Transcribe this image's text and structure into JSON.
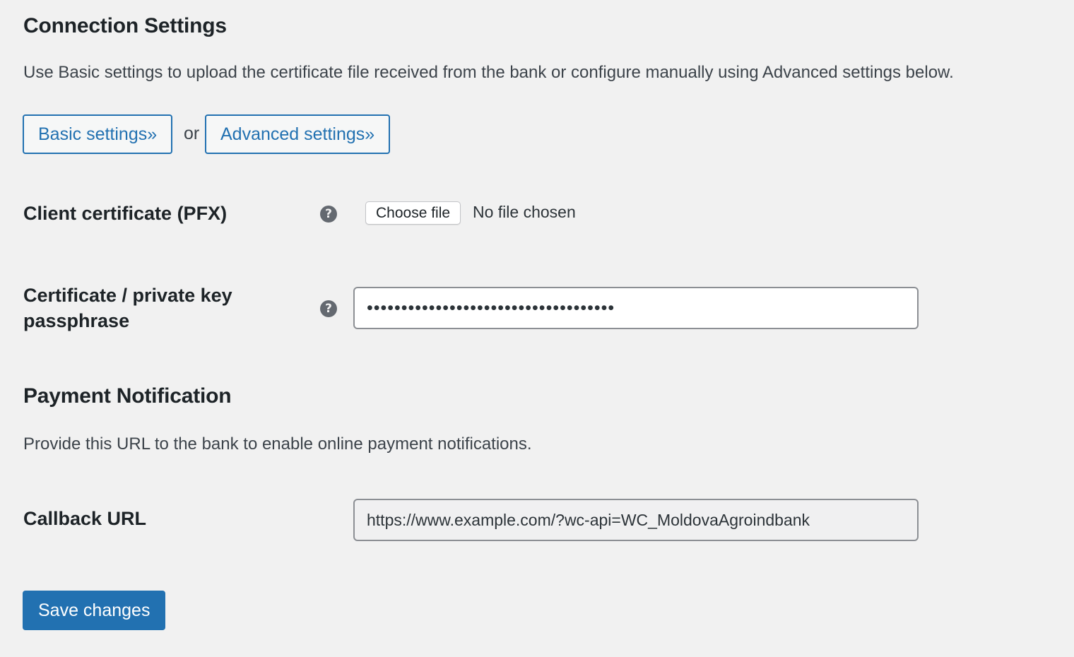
{
  "connection": {
    "title": "Connection Settings",
    "description": "Use Basic settings to upload the certificate file received from the bank or configure manually using Advanced settings below.",
    "basic_button": "Basic settings»",
    "or_text": "or",
    "advanced_button": "Advanced settings»"
  },
  "fields": {
    "certificate": {
      "label": "Client certificate (PFX)",
      "help_icon": "question-circle-icon",
      "choose_button": "Choose file",
      "status": "No file chosen"
    },
    "passphrase": {
      "label_line1": "Certificate / private key",
      "label_line2": "passphrase",
      "help_icon": "question-circle-icon",
      "value": "••••••••••••••••••••••••••••••••••••"
    }
  },
  "notification": {
    "title": "Payment Notification",
    "description": "Provide this URL to the bank to enable online payment notifications.",
    "callback_label": "Callback URL",
    "callback_value": "https://www.example.com/?wc-api=WC_MoldovaAgroindbank"
  },
  "actions": {
    "save_button": "Save changes"
  },
  "colors": {
    "background": "#f1f1f1",
    "accent": "#2271b1",
    "text": "#1d2327",
    "help_icon": "#646970"
  }
}
